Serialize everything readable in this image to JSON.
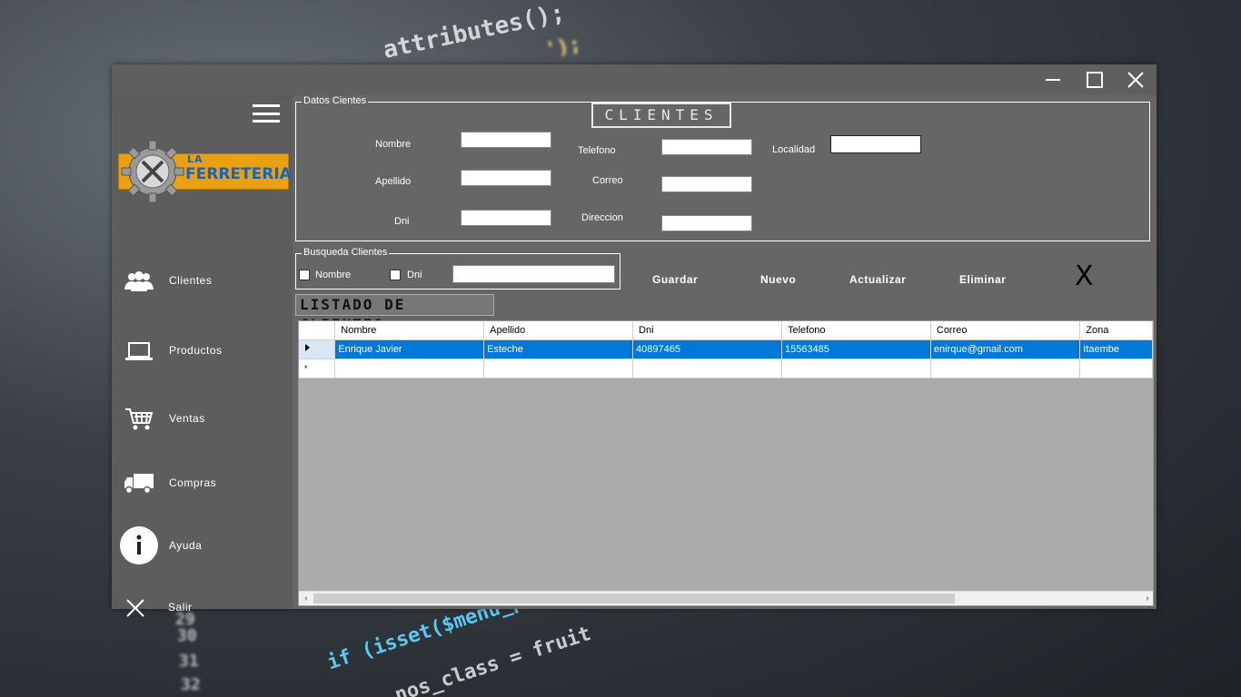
{
  "window": {
    "controls": {
      "minimize_icon": "minimize-icon",
      "maximize_icon": "maximize-icon",
      "close_icon": "close-icon"
    }
  },
  "sidebar": {
    "logo": {
      "top": "LA",
      "bottom": "FERRETERIA"
    },
    "items": [
      {
        "label": "Clientes",
        "icon": "users-icon"
      },
      {
        "label": "Productos",
        "icon": "laptop-icon"
      },
      {
        "label": "Ventas",
        "icon": "cart-icon"
      },
      {
        "label": "Compras",
        "icon": "truck-icon"
      },
      {
        "label": "Ayuda",
        "icon": "info-icon"
      },
      {
        "label": "Salir",
        "icon": "close-icon"
      }
    ]
  },
  "datos": {
    "group_title": "Datos Cientes",
    "heading": "CLIENTES",
    "labels": {
      "nombre": "Nombre",
      "apellido": "Apellido",
      "dni": "Dni",
      "telefono": "Telefono",
      "correo": "Correo",
      "direccion": "Direccion",
      "localidad": "Localidad"
    },
    "values": {
      "nombre": "",
      "apellido": "",
      "dni": "",
      "telefono": "",
      "correo": "",
      "direccion": "",
      "localidad": ""
    }
  },
  "busqueda": {
    "group_title": "Busqueda Clientes",
    "check_nombre": "Nombre",
    "check_dni": "Dni",
    "search_value": ""
  },
  "actions": {
    "guardar": "Guardar",
    "nuevo": "Nuevo",
    "actualizar": "Actualizar",
    "eliminar": "Eliminar",
    "close_x": "X"
  },
  "listado": {
    "title": "LISTADO DE CLIENTES",
    "columns": [
      "Nombre",
      "Apellido",
      "Dni",
      "Telefono",
      "Correo",
      "Zona"
    ],
    "rows": [
      [
        "Enrique Javier",
        "Esteche",
        "40897465",
        "15563485",
        "enirque@gmail.com",
        "Itaembe"
      ]
    ],
    "new_row_marker": "*"
  },
  "background": {
    "line1": "attributes();",
    "line2": "if (isset($menu_pos",
    "line3": "nos_class = fruit",
    "gutter": [
      "29",
      "30",
      "31",
      "32"
    ]
  },
  "colors": {
    "selection": "#0078d7",
    "window_bg": "#666666",
    "logo_orange": "#e9a012",
    "logo_blue": "#1565c0"
  }
}
